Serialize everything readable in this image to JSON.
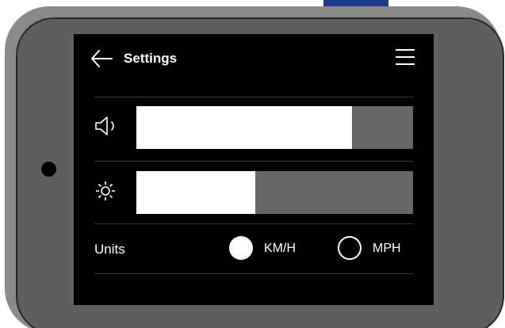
{
  "screen": {
    "title": "Settings",
    "back_icon": "arrow-left-icon",
    "menu_icon": "hamburger-menu-icon"
  },
  "volume": {
    "icon": "speaker-icon",
    "level_percent": 78
  },
  "brightness": {
    "icon": "sun-icon",
    "level_percent": 43
  },
  "units": {
    "label": "Units",
    "options": [
      {
        "label": "KM/H",
        "selected": true
      },
      {
        "label": "MPH",
        "selected": false
      }
    ]
  },
  "colors": {
    "screen_bg": "#000000",
    "fill": "#ffffff",
    "track": "#666666",
    "bezel": "#5f5f5f",
    "accent_tab": "#1f3b8c"
  }
}
